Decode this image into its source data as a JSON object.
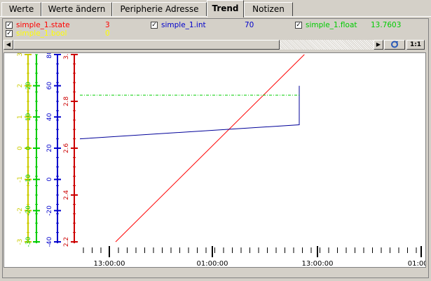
{
  "tabs": [
    {
      "label": "Werte",
      "active": false
    },
    {
      "label": "Werte ändern",
      "active": false
    },
    {
      "label": "Peripherie Adresse",
      "active": false
    },
    {
      "label": "Trend",
      "active": true
    },
    {
      "label": "Notizen",
      "active": false
    }
  ],
  "legend": [
    {
      "name": "simple_1.state",
      "value": "3",
      "color": "#ff0000",
      "checked": true
    },
    {
      "name": "simple_1.int",
      "value": "70",
      "color": "#0000cc",
      "checked": true
    },
    {
      "name": "simple_1.float",
      "value": "13.7603",
      "color": "#00cc00",
      "checked": true
    },
    {
      "name": "simple_1.bool",
      "value": "0",
      "color": "#ffff00",
      "checked": true
    }
  ],
  "toolbar": {
    "ratio_label": "1:1",
    "refresh_icon": "refresh-icon"
  },
  "scrollbar": {
    "left_icon": "arrow-left-icon",
    "right_icon": "arrow-right-icon"
  },
  "chart_data": {
    "type": "line",
    "x_tick_labels": [
      "13:00:00",
      "01:00:00",
      "13:00:00",
      "01:00:0"
    ],
    "axes": [
      {
        "color": "#cccc00",
        "range": [
          -3,
          3
        ],
        "ticks": [
          -3,
          -2,
          -1,
          0,
          1,
          2,
          3
        ],
        "tick_labels": [
          "-3",
          "-2",
          "-1",
          "0",
          "1",
          "2",
          "3"
        ]
      },
      {
        "color": "#00cc00",
        "range": [
          -30,
          30
        ],
        "ticks": [
          -30,
          -20,
          -10,
          0,
          10,
          20
        ],
        "tick_labels": [
          "-30",
          "-20",
          "-10",
          "0",
          "10",
          "20"
        ]
      },
      {
        "color": "#0000cc",
        "range": [
          -40,
          80
        ],
        "ticks": [
          -40,
          -20,
          0,
          20,
          40,
          60,
          80
        ],
        "tick_labels": [
          "-40",
          "-20",
          "0",
          "20",
          "40",
          "60",
          "80"
        ]
      },
      {
        "color": "#cc0000",
        "range": [
          2.2,
          3.0
        ],
        "ticks": [
          2.2,
          2.4,
          2.6,
          2.8,
          3.0
        ],
        "tick_labels": [
          "2.2",
          "2.4",
          "2.6",
          "2.8",
          "3.0"
        ]
      }
    ],
    "series": [
      {
        "name": "simple_1.state",
        "color": "#ff0000",
        "points": [
          [
            0.105,
            2.2
          ],
          [
            0.66,
            3.0
          ]
        ]
      },
      {
        "name": "simple_1.int",
        "color": "#000099",
        "points": [
          [
            0.0,
            26
          ],
          [
            0.645,
            35
          ],
          [
            0.645,
            60
          ]
        ]
      },
      {
        "name": "simple_1.float",
        "color": "#00cc00",
        "dashed": true,
        "points": [
          [
            0.0,
            17
          ],
          [
            0.645,
            17
          ]
        ]
      }
    ]
  }
}
